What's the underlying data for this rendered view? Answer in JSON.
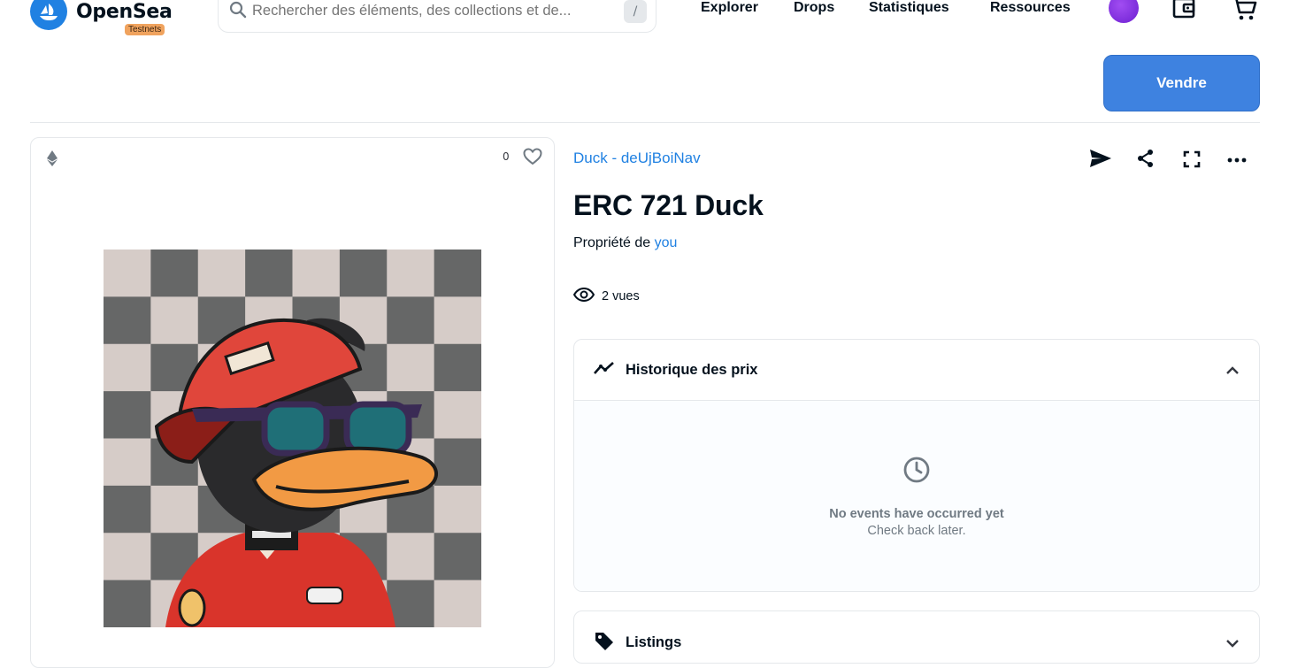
{
  "header": {
    "brand": "OpenSea",
    "badge": "Testnets",
    "search_placeholder": "Rechercher des éléments, des collections et de...",
    "search_shortcut": "/",
    "nav": [
      "Explorer",
      "Drops",
      "Statistiques",
      "Ressources"
    ],
    "sell_label": "Vendre"
  },
  "media": {
    "favorite_count": "0"
  },
  "item": {
    "collection": "Duck - deUjBoiNav",
    "title": "ERC 721 Duck",
    "owned_by_prefix": "Propriété de",
    "owner": "you",
    "views": "2 vues"
  },
  "price_history": {
    "title": "Historique des prix",
    "empty_title": "No events have occurred yet",
    "empty_sub": "Check back later."
  },
  "listings": {
    "title": "Listings"
  },
  "colors": {
    "accent": "#2081e2",
    "sell_button": "#3e82e0",
    "badge": "#f0a35e"
  }
}
